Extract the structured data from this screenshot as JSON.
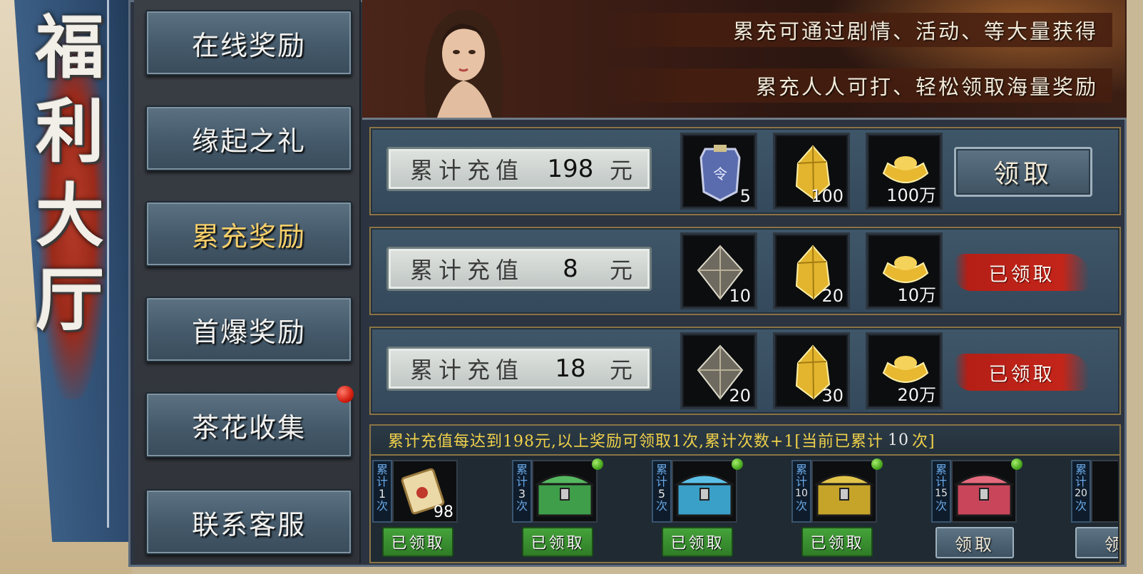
{
  "banner": {
    "title_chars": [
      "福",
      "利",
      "大",
      "厅"
    ]
  },
  "nav": {
    "items": [
      {
        "label": "在线奖励",
        "active": false
      },
      {
        "label": "缘起之礼",
        "active": false
      },
      {
        "label": "累充奖励",
        "active": true
      },
      {
        "label": "首爆奖励",
        "active": false
      },
      {
        "label": "茶花收集",
        "active": false,
        "badge": true
      },
      {
        "label": "联系客服",
        "active": false
      }
    ]
  },
  "hero": {
    "line1": "累充可通过剧情、活动、等大量获得",
    "line2": "累充人人可打、轻松领取海量奖励"
  },
  "rewards": {
    "label_prefix": "累计充值",
    "label_suffix": "元",
    "rows": [
      {
        "amount": "198",
        "items": [
          {
            "icon": "token-icon",
            "count": "5"
          },
          {
            "icon": "gold-crystal-icon",
            "count": "100"
          },
          {
            "icon": "gold-ingot-icon",
            "count": "100万"
          }
        ],
        "status": "claim",
        "status_label": "领取"
      },
      {
        "amount": "8",
        "items": [
          {
            "icon": "silver-gem-icon",
            "count": "10"
          },
          {
            "icon": "gold-crystal-icon",
            "count": "20"
          },
          {
            "icon": "gold-ingot-icon",
            "count": "10万"
          }
        ],
        "status": "claimed",
        "status_label": "已领取"
      },
      {
        "amount": "18",
        "items": [
          {
            "icon": "silver-gem-icon",
            "count": "20"
          },
          {
            "icon": "gold-crystal-icon",
            "count": "30"
          },
          {
            "icon": "gold-ingot-icon",
            "count": "20万"
          }
        ],
        "status": "claimed",
        "status_label": "已领取"
      }
    ]
  },
  "cumulative": {
    "info_text": "累计充值每达到198元,以上奖励可领取1次,累计次数+1[当前已累计",
    "current_count": "10",
    "info_tail": "次]",
    "milestones": [
      {
        "tag": [
          "累",
          "计",
          "1",
          "次"
        ],
        "icon": "scroll-icon",
        "count": "98",
        "status": "已领取",
        "claimed": true,
        "dot": false
      },
      {
        "tag": [
          "累",
          "计",
          "3",
          "次"
        ],
        "icon": "green-chest-icon",
        "count": "",
        "status": "已领取",
        "claimed": true,
        "dot": true,
        "color": "#3f9e4a"
      },
      {
        "tag": [
          "累",
          "计",
          "5",
          "次"
        ],
        "icon": "blue-chest-icon",
        "count": "",
        "status": "已领取",
        "claimed": true,
        "dot": true,
        "color": "#3aa0c8"
      },
      {
        "tag": [
          "累",
          "计",
          "10",
          "次"
        ],
        "icon": "gold-chest-icon",
        "count": "",
        "status": "已领取",
        "claimed": true,
        "dot": true,
        "color": "#c6a42a"
      },
      {
        "tag": [
          "累",
          "计",
          "15",
          "次"
        ],
        "icon": "red-chest-icon",
        "count": "",
        "status": "领取",
        "claimed": false,
        "dot": true,
        "color": "#c8455a"
      },
      {
        "tag": [
          "累",
          "计",
          "20",
          "次"
        ],
        "icon": "chest-icon",
        "count": "",
        "status": "领",
        "claimed": false,
        "dot": false,
        "color": "#777"
      }
    ]
  },
  "colors": {
    "gold_text": "#f0d14a",
    "active_nav": "#f6cf6a",
    "claimed_red": "#c4251a",
    "claimed_green": "#3f9b34"
  }
}
